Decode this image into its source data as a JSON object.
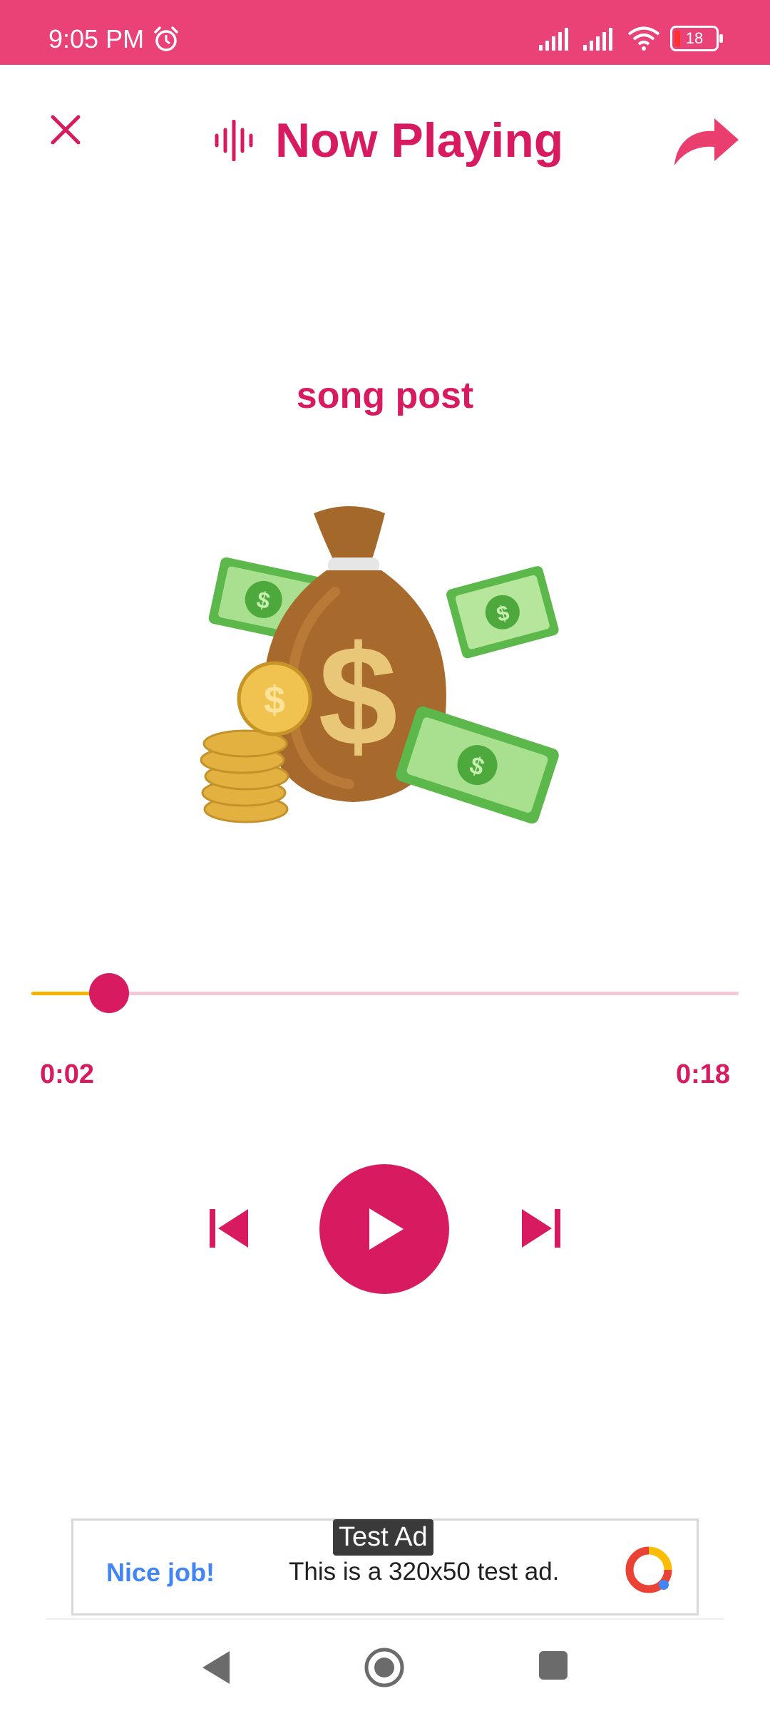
{
  "status_bar": {
    "time": "9:05 PM",
    "battery_level": "18",
    "background_color": "#ea4177",
    "icons": [
      "alarm-icon",
      "signal-icon",
      "signal-icon",
      "wifi-icon",
      "battery-icon"
    ]
  },
  "header": {
    "title": "Now Playing",
    "left_icon": "close-icon",
    "title_icon": "sound-wave-icon",
    "right_icon": "share-icon"
  },
  "track": {
    "title": "song post",
    "artwork": "money-bag-illustration",
    "elapsed": "0:02",
    "duration": "0:18",
    "progress_fraction": 0.11
  },
  "controls": {
    "previous": "skip-previous-icon",
    "play": "play-icon",
    "next": "skip-next-icon"
  },
  "ad": {
    "badge": "Test Ad",
    "cta": "Nice job!",
    "text": "This is a 320x50 test ad."
  },
  "colors": {
    "accent": "#d81b60",
    "progress_played": "#f4b400",
    "progress_track": "#f6c8d5"
  }
}
